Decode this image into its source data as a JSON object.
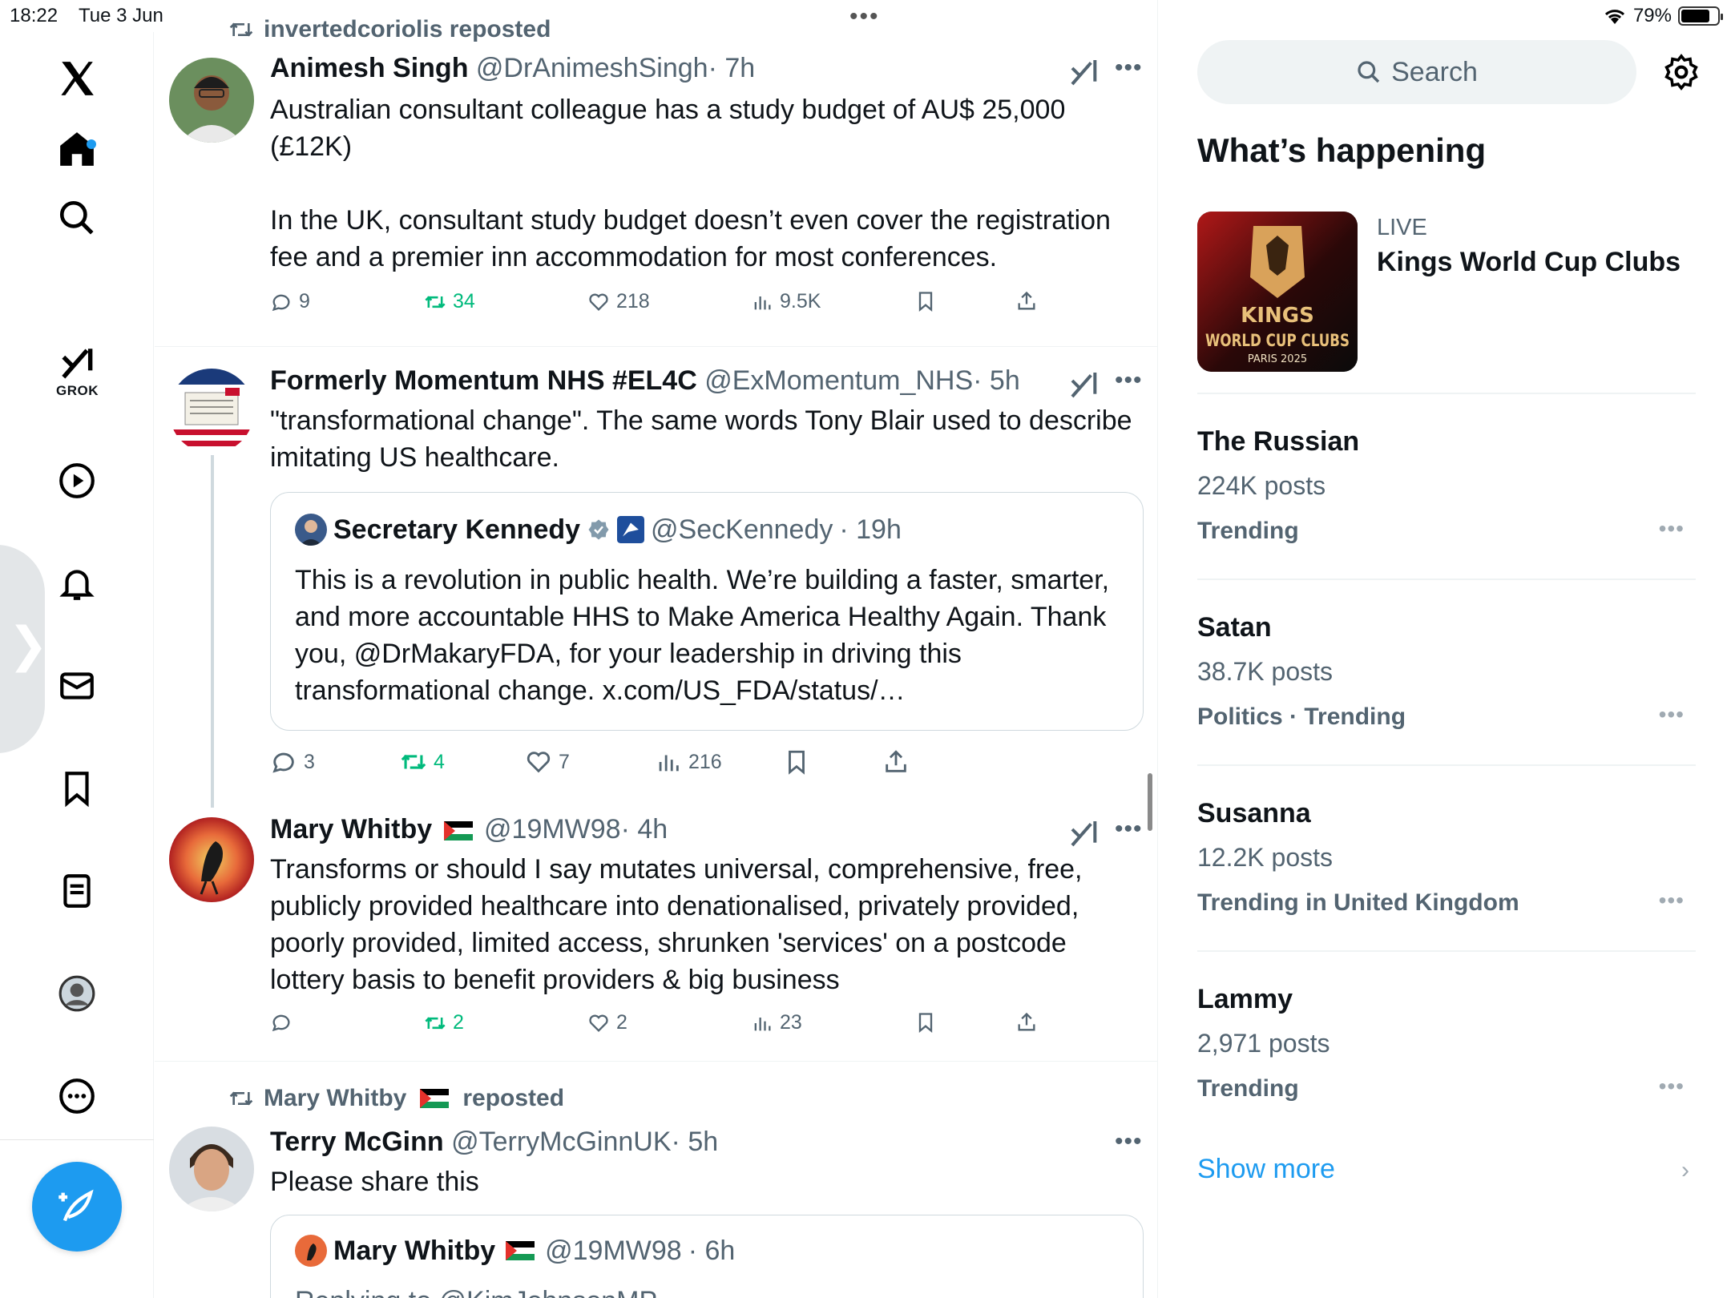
{
  "status_bar": {
    "time": "18:22",
    "date": "Tue 3 Jun",
    "battery": "79%",
    "battery_level": 0.79
  },
  "nav": {
    "grok_label": "GROK",
    "items": [
      "x-logo",
      "home",
      "search",
      "grok",
      "video",
      "notifications",
      "messages",
      "bookmarks",
      "lists",
      "profile",
      "more"
    ]
  },
  "feed": {
    "tweets": [
      {
        "repost_by": "invertedcoriolis reposted",
        "name": "Animesh Singh",
        "handle": "@DrAnimeshSingh",
        "time": "· 7h",
        "text": "Australian consultant colleague has a study budget of AU$ 25,000 (£12K)\n\nIn the UK, consultant study budget doesn’t even cover the registration fee and a premier inn accommodation for most conferences.",
        "replies": "9",
        "reposts": "34",
        "likes": "218",
        "views": "9.5K"
      },
      {
        "name": "Formerly Momentum NHS #EL4C",
        "handle": "@ExMomentum_NHS",
        "time": "· 5h",
        "text": "\"transformational change\". The same words Tony Blair used to describe imitating US healthcare.",
        "quote": {
          "name": "Secretary Kennedy",
          "handle": "@SecKennedy",
          "time": "· 19h",
          "text": "This is a revolution in public health. We’re building a faster, smarter, and more accountable HHS to Make America Healthy Again. Thank you, @DrMakaryFDA, for your leadership in driving this transformational change. x.com/US_FDA/status/…"
        },
        "replies": "3",
        "reposts": "4",
        "likes": "7",
        "views": "216"
      },
      {
        "name": "Mary Whitby",
        "handle": "@19MW98",
        "time": "· 4h",
        "text": "Transforms or should I say mutates universal, comprehensive, free, publicly provided healthcare into denationalised, privately provided, poorly provided, limited access, shrunken 'services' on a postcode lottery basis to benefit providers & big business",
        "replies": "",
        "reposts": "2",
        "likes": "2",
        "views": "23"
      },
      {
        "repost_name": "Mary Whitby",
        "repost_suffix": "reposted",
        "name": "Terry McGinn",
        "handle": "@TerryMcGinnUK",
        "time": "· 5h",
        "text": "Please share this",
        "quote": {
          "name": "Mary Whitby",
          "handle": "@19MW98",
          "time": "· 6h",
          "partial_text": "Replying to @KimJohnsonMP"
        }
      }
    ]
  },
  "sidebar": {
    "search_placeholder": "Search",
    "section_title": "What’s happening",
    "live": {
      "label": "LIVE",
      "title": "Kings World Cup Clubs",
      "image_text_1": "KINGS",
      "image_text_2": "WORLD CUP CLUBS",
      "image_text_3": "PARIS 2025"
    },
    "trends": [
      {
        "name": "The Russian",
        "posts": "224K posts",
        "category": "Trending"
      },
      {
        "name": "Satan",
        "posts": "38.7K posts",
        "category": "Politics · Trending"
      },
      {
        "name": "Susanna",
        "posts": "12.2K posts",
        "category": "Trending in United Kingdom"
      },
      {
        "name": "Lammy",
        "posts": "2,971 posts",
        "category": "Trending"
      }
    ],
    "show_more": "Show more"
  },
  "colors": {
    "accent": "#1d9bf0",
    "repost_green": "#00ba7c",
    "secondary_text": "#536471"
  }
}
